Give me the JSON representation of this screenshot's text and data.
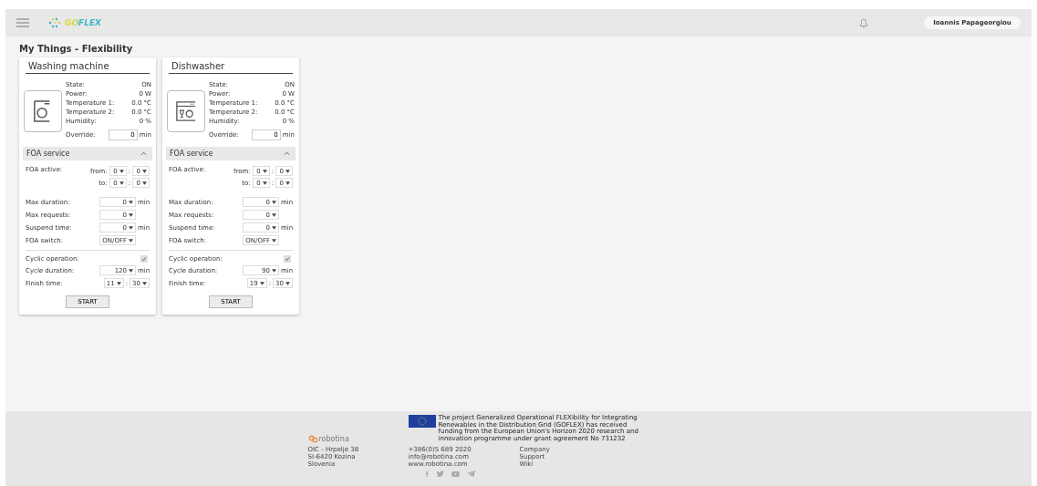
{
  "header": {
    "logo": "GOFLEX",
    "user": "Ioannis Papageorgiou"
  },
  "page_title": "My Things - Flexibility",
  "devices": [
    {
      "name": "Washing machine",
      "kind": "washer",
      "readings": [
        {
          "label": "State:",
          "value": "ON"
        },
        {
          "label": "Power:",
          "value": "0 W"
        },
        {
          "label": "Temperature 1:",
          "value": "0.0 °C"
        },
        {
          "label": "Temperature 2:",
          "value": "0.0 °C"
        },
        {
          "label": "Humidity:",
          "value": "0 %"
        }
      ],
      "override": {
        "label": "Override:",
        "value": "0",
        "unit": "min"
      },
      "foa": {
        "title": "FOA service",
        "expanded": true,
        "groups": [
          {
            "kind": "fields",
            "rows": [
              {
                "kind": "range",
                "label": "FOA active:",
                "from_label": "from:",
                "from": [
                  "0",
                  "0"
                ],
                "to_label": "to:",
                "to": [
                  "0",
                  "0"
                ],
                "separator": ":"
              }
            ]
          },
          {
            "kind": "fields",
            "rows": [
              {
                "kind": "select",
                "label": "Max duration:",
                "value": "0",
                "unit": "min"
              },
              {
                "kind": "select",
                "label": "Max requests:",
                "value": "0"
              },
              {
                "kind": "select",
                "label": "Suspend time:",
                "value": "0",
                "unit": "min"
              },
              {
                "kind": "select",
                "label": "FOA switch:",
                "value": "ON/OFF"
              }
            ]
          },
          {
            "kind": "divider"
          },
          {
            "kind": "fields",
            "rows": [
              {
                "kind": "check",
                "label": "Cyclic operation:",
                "checked": true
              },
              {
                "kind": "select",
                "label": "Cycle duration:",
                "value": "120",
                "unit": "min"
              },
              {
                "kind": "time",
                "label": "Finish time:",
                "values": [
                  "11",
                  "30"
                ],
                "separator": ":"
              }
            ]
          }
        ]
      },
      "button": "START"
    },
    {
      "name": "Dishwasher",
      "kind": "dishwasher",
      "readings": [
        {
          "label": "State:",
          "value": "ON"
        },
        {
          "label": "Power:",
          "value": "0 W"
        },
        {
          "label": "Temperature 1:",
          "value": "0.0 °C"
        },
        {
          "label": "Temperature 2:",
          "value": "0.0 °C"
        },
        {
          "label": "Humidity:",
          "value": "0 %"
        }
      ],
      "override": {
        "label": "Override:",
        "value": "0",
        "unit": "min"
      },
      "foa": {
        "title": "FOA service",
        "expanded": true,
        "groups": [
          {
            "kind": "fields",
            "rows": [
              {
                "kind": "range",
                "label": "FOA active:",
                "from_label": "from:",
                "from": [
                  "0",
                  "0"
                ],
                "to_label": "to:",
                "to": [
                  "0",
                  "0"
                ],
                "separator": ":"
              }
            ]
          },
          {
            "kind": "fields",
            "rows": [
              {
                "kind": "select",
                "label": "Max duration:",
                "value": "0",
                "unit": "min"
              },
              {
                "kind": "select",
                "label": "Max requests:",
                "value": "0"
              },
              {
                "kind": "select",
                "label": "Suspend time:",
                "value": "0",
                "unit": "min"
              },
              {
                "kind": "select",
                "label": "FOA switch:",
                "value": "ON/OFF"
              }
            ]
          },
          {
            "kind": "divider"
          },
          {
            "kind": "fields",
            "rows": [
              {
                "kind": "check",
                "label": "Cyclic operation:",
                "checked": true
              },
              {
                "kind": "select",
                "label": "Cycle duration:",
                "value": "90",
                "unit": "min"
              },
              {
                "kind": "time",
                "label": "Finish time:",
                "values": [
                  "19",
                  "30"
                ],
                "separator": ":"
              }
            ]
          }
        ]
      },
      "button": "START"
    }
  ],
  "footer": {
    "brand": "robotina",
    "eu_text": "The project Generalized Operational FLEXibility for Integrating Renewables in the Distribution Grid (GOFLEX) has received funding from the European Union's Horizon 2020 research and innovation programme under grant agreement No 731232",
    "address": [
      "OIC - Hrpelje 38",
      "SI-6420 Kozina",
      "Slovenia"
    ],
    "contact": [
      "+386(0)5 689 2020",
      "info@robotina.com",
      "www.robotina.com"
    ],
    "links": [
      "Company",
      "Support",
      "Wiki"
    ]
  }
}
